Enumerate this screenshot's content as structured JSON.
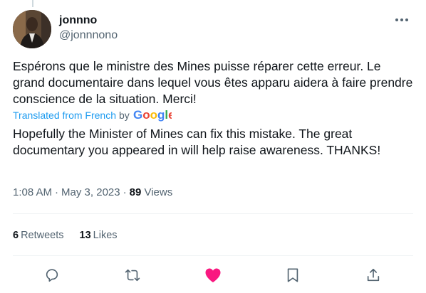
{
  "author": {
    "display_name": "jonnno",
    "handle": "@jonnnono"
  },
  "tweet": {
    "text": "Espérons que le ministre des Mines puisse réparer cette erreur. Le grand documentaire dans lequel vous êtes apparu aidera à faire prendre conscience de la situation. Merci!",
    "translated_label": "Translated from French",
    "translated_by": "by",
    "translation": "Hopefully the Minister of Mines can fix this mistake. The great documentary you appeared in will help raise awareness. THANKS!",
    "translation_provider": "Google"
  },
  "meta": {
    "time": "1:08 AM",
    "separator": "·",
    "date": "May 3, 2023",
    "views_count": "89",
    "views_label": "Views"
  },
  "stats": {
    "retweets_count": "6",
    "retweets_label": "Retweets",
    "likes_count": "13",
    "likes_label": "Likes"
  },
  "colors": {
    "link_blue": "#1d9bf0",
    "secondary_text": "#536471",
    "icon_gray": "#536471",
    "like_pink": "#f91880",
    "divider": "#eff3f4"
  },
  "icons": {
    "reply": "reply-icon",
    "retweet": "retweet-icon",
    "like": "heart-filled-icon",
    "bookmark": "bookmark-icon",
    "share": "share-icon",
    "more": "more-icon"
  }
}
